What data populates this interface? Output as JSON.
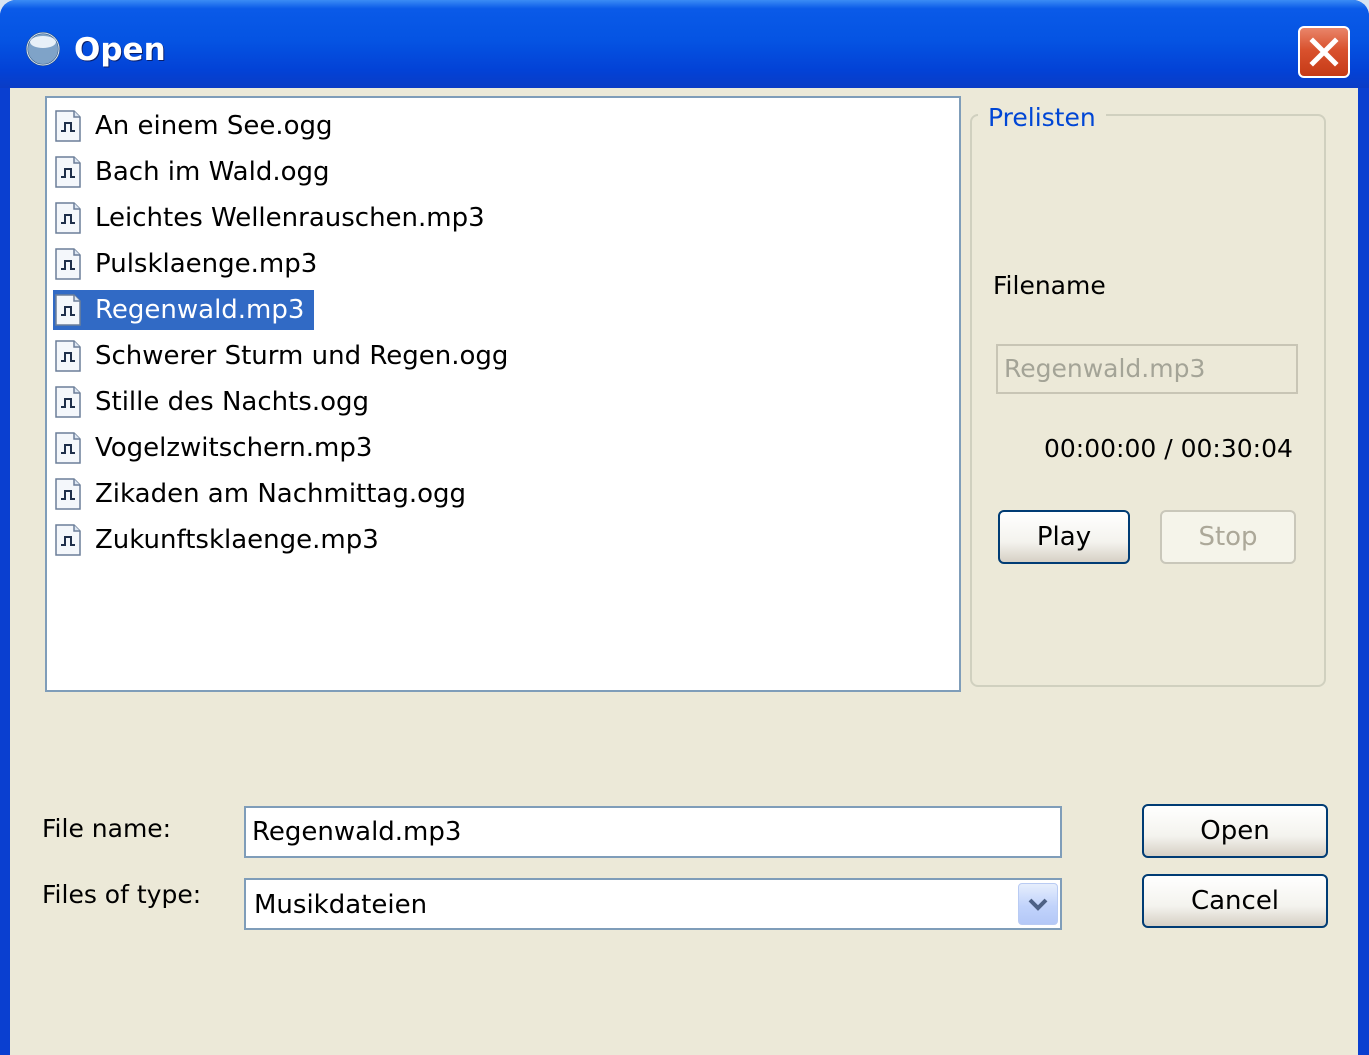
{
  "window": {
    "title": "Open",
    "app_icon": "app-globe-icon",
    "close_icon": "close-icon"
  },
  "file_list": {
    "items": [
      {
        "name": "An einem See.ogg",
        "icon": "audio-file-icon"
      },
      {
        "name": "Bach im Wald.ogg",
        "icon": "audio-file-icon"
      },
      {
        "name": "Leichtes Wellenrauschen.mp3",
        "icon": "audio-file-icon"
      },
      {
        "name": "Pulsklaenge.mp3",
        "icon": "audio-file-icon"
      },
      {
        "name": "Regenwald.mp3",
        "icon": "audio-file-icon",
        "selected": true
      },
      {
        "name": "Schwerer Sturm und Regen.ogg",
        "icon": "audio-file-icon"
      },
      {
        "name": "Stille des Nachts.ogg",
        "icon": "audio-file-icon"
      },
      {
        "name": "Vogelzwitschern.mp3",
        "icon": "audio-file-icon"
      },
      {
        "name": "Zikaden am Nachmittag.ogg",
        "icon": "audio-file-icon"
      },
      {
        "name": "Zukunftsklaenge.mp3",
        "icon": "audio-file-icon"
      }
    ]
  },
  "prelisten": {
    "title": "Prelisten",
    "filename_label": "Filename",
    "filename_value": "Regenwald.mp3",
    "time": "00:00:00 / 00:30:04",
    "play_label": "Play",
    "stop_label": "Stop"
  },
  "form": {
    "file_name_label": "File name:",
    "file_name_value": "Regenwald.mp3",
    "files_of_type_label": "Files of type:",
    "files_of_type_value": "Musikdateien",
    "open_label": "Open",
    "cancel_label": "Cancel"
  },
  "colors": {
    "titlebar": "#0554e3",
    "selection": "#316ac5",
    "group_title": "#0046d5",
    "dialog_bg": "#ece9d8"
  }
}
